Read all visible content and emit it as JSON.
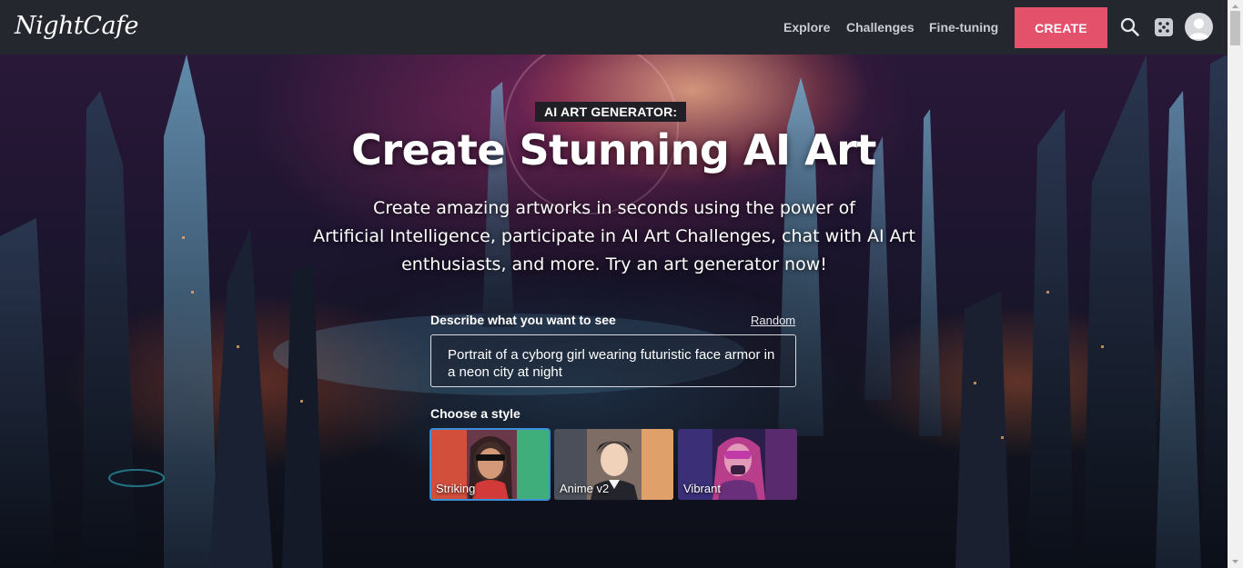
{
  "header": {
    "logo": "NightCafe",
    "nav": [
      "Explore",
      "Challenges",
      "Fine-tuning"
    ],
    "create_label": "CREATE"
  },
  "hero": {
    "eyebrow": "AI ART GENERATOR:",
    "title": "Create Stunning AI Art",
    "subtitle_lines": [
      "Create amazing artworks in seconds using the power of",
      "Artificial Intelligence, participate in AI Art Challenges, chat with AI Art",
      "enthusiasts, and more. Try an art generator now!"
    ]
  },
  "prompt": {
    "label": "Describe what you want to see",
    "random_label": "Random",
    "value": "Portrait of a cyborg girl wearing futuristic face armor in a neon city at night"
  },
  "styles": {
    "label": "Choose a style",
    "items": [
      {
        "name": "Striking",
        "selected": true
      },
      {
        "name": "Anime v2",
        "selected": false
      },
      {
        "name": "Vibrant",
        "selected": false
      }
    ]
  },
  "colors": {
    "accent": "#e3516b",
    "topbar": "#24272e",
    "selected_outline": "#3a8fd8"
  },
  "icons": [
    "search-icon",
    "dice-icon",
    "user-avatar-icon"
  ]
}
